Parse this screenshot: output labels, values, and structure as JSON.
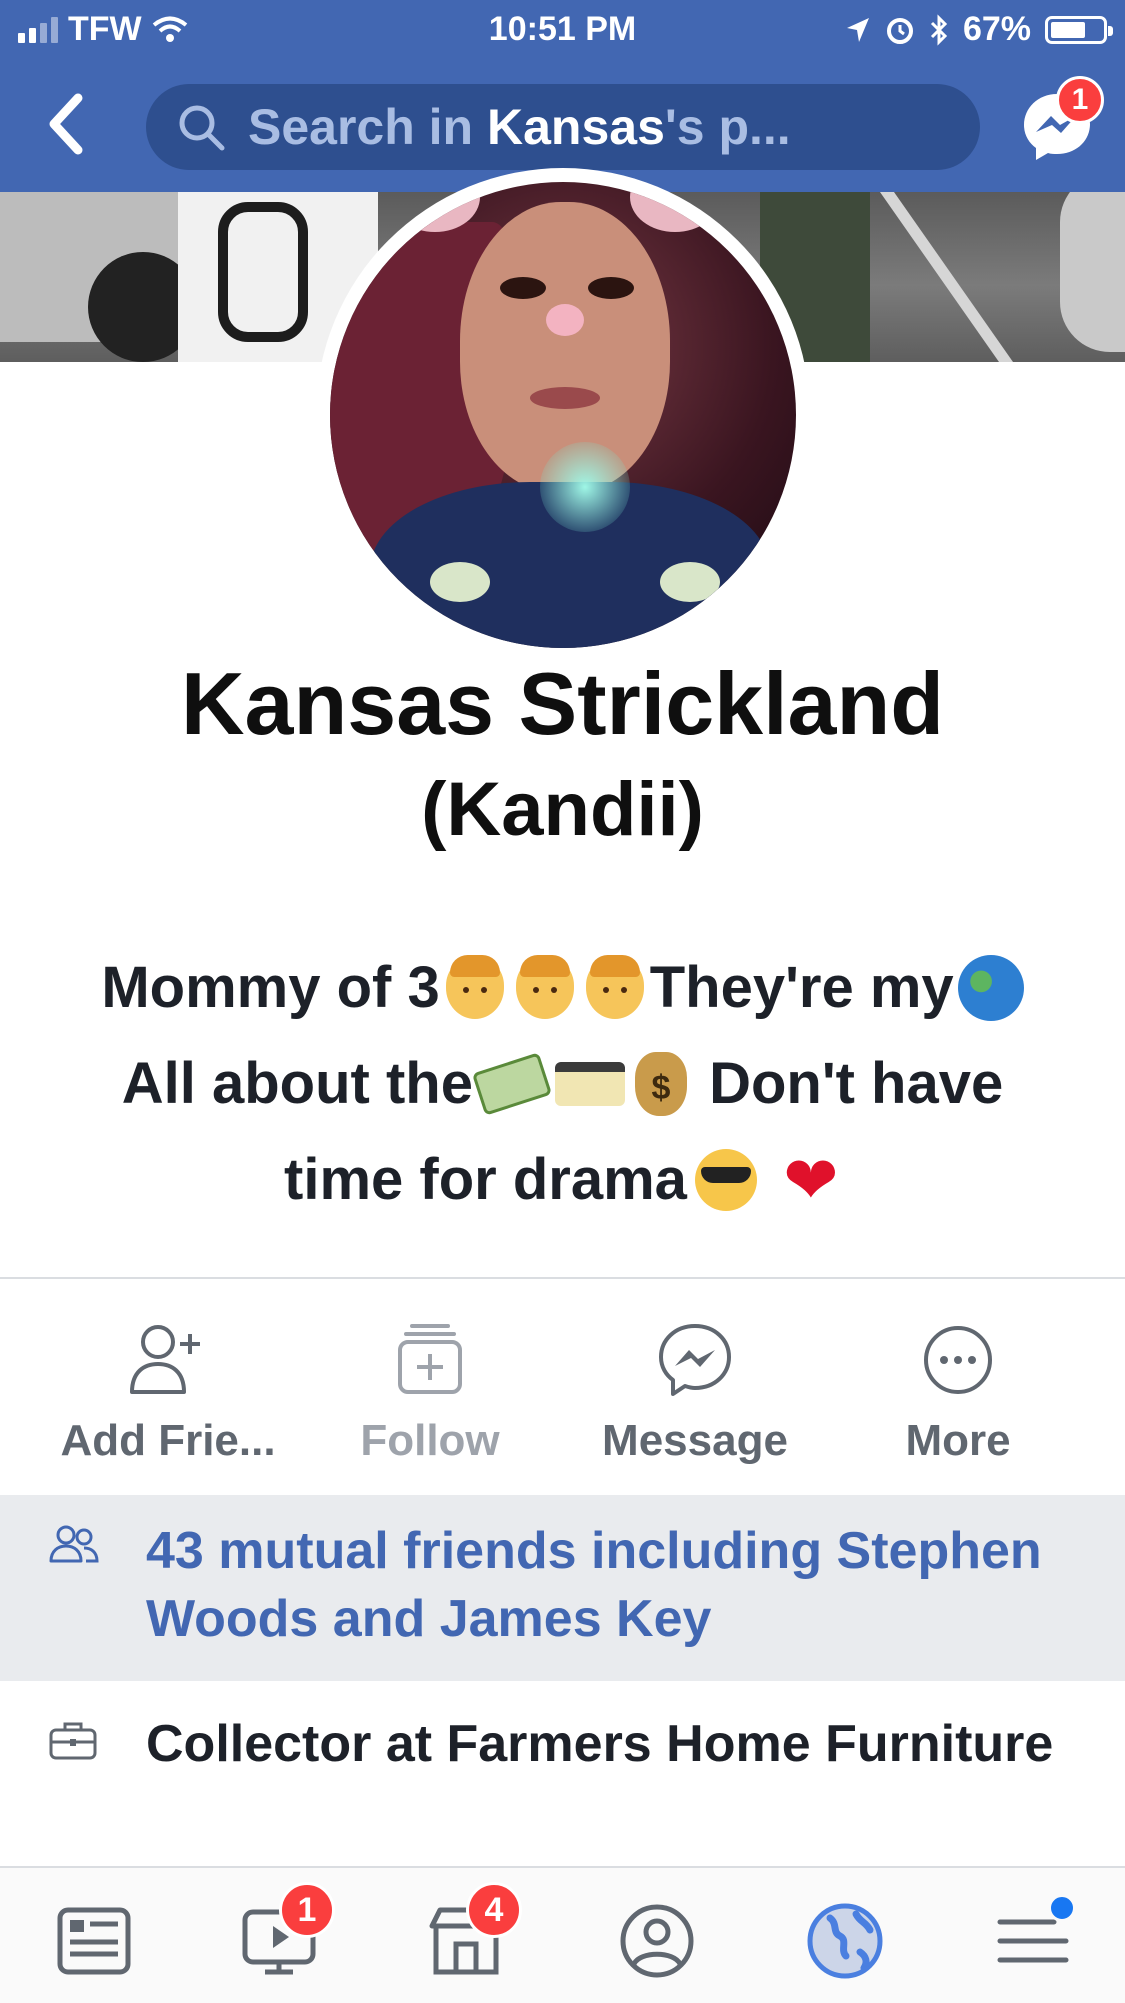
{
  "status_bar": {
    "carrier": "TFW",
    "time": "10:51 PM",
    "battery_percent": "67%",
    "battery_level": 0.67
  },
  "nav": {
    "back_icon": "chevron-left-icon",
    "search": {
      "prefix": "Search in ",
      "profile_name": "Kansas",
      "suffix": "'s p..."
    },
    "messenger_badge": "1"
  },
  "profile": {
    "name": "Kansas Strickland",
    "nickname": "(Kandii)",
    "bio": {
      "line1_text_a": "Mommy of 3",
      "line1_text_b": "They're my",
      "line2_text_a": "All about the",
      "line2_text_b": "Don't have",
      "line3_text_a": "time for drama",
      "emojis": [
        "boy",
        "boy",
        "boy",
        "globe",
        "money-with-wings",
        "credit-card",
        "money-bag",
        "smiling-face-with-sunglasses",
        "red-heart"
      ]
    }
  },
  "actions": [
    {
      "label": "Add Frie...",
      "icon": "add-friend-icon"
    },
    {
      "label": "Follow",
      "icon": "follow-icon"
    },
    {
      "label": "Message",
      "icon": "messenger-icon"
    },
    {
      "label": "More",
      "icon": "more-icon"
    }
  ],
  "mutual_friends": {
    "text": "43 mutual friends including Stephen Woods and James Key",
    "icon": "friends-icon"
  },
  "work": {
    "text": "Collector at Farmers Home Furniture",
    "icon": "briefcase-icon"
  },
  "tabbar": {
    "tabs": [
      {
        "name": "news-feed",
        "icon": "news-feed-icon"
      },
      {
        "name": "watch",
        "icon": "watch-icon",
        "badge": "1"
      },
      {
        "name": "marketplace",
        "icon": "marketplace-icon",
        "badge": "4"
      },
      {
        "name": "profile",
        "icon": "profile-icon"
      },
      {
        "name": "notifications",
        "icon": "globe-icon"
      },
      {
        "name": "menu",
        "icon": "menu-icon"
      }
    ]
  },
  "colors": {
    "brand_blue": "#4267b2",
    "badge_red": "#fa3e3e",
    "highlight_bg": "#e9ebee"
  }
}
